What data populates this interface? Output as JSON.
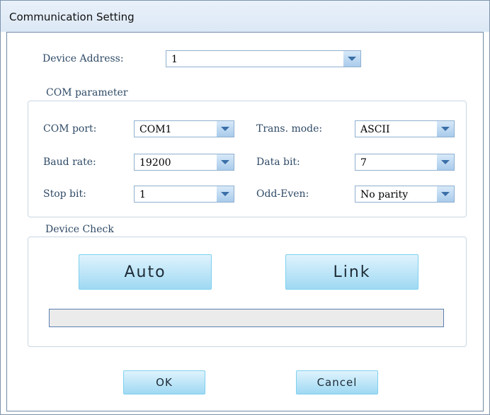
{
  "window": {
    "title": "Communication Setting"
  },
  "device_address": {
    "label": "Device Address:",
    "value": "1"
  },
  "com_group": {
    "title": "COM parameter",
    "com_port": {
      "label": "COM port:",
      "value": "COM1"
    },
    "trans_mode": {
      "label": "Trans. mode:",
      "value": "ASCII"
    },
    "baud_rate": {
      "label": "Baud rate:",
      "value": "19200"
    },
    "data_bit": {
      "label": "Data bit:",
      "value": "7"
    },
    "stop_bit": {
      "label": "Stop bit:",
      "value": "1"
    },
    "odd_even": {
      "label": "Odd-Even:",
      "value": "No parity"
    }
  },
  "device_check": {
    "title": "Device Check",
    "auto_label": "Auto",
    "link_label": "Link",
    "progress": 0
  },
  "buttons": {
    "ok_label": "OK",
    "cancel_label": "Cancel"
  }
}
